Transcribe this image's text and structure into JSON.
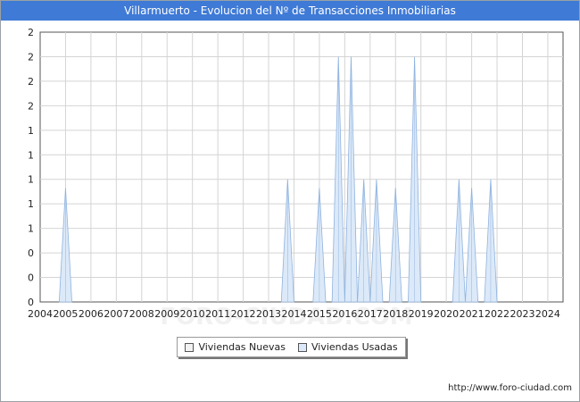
{
  "title": "Villarmuerto - Evolucion del Nº de Transacciones Inmobiliarias",
  "source": "http://www.foro-ciudad.com",
  "watermark": "FORO-CIUDAD.COM",
  "colors": {
    "title_bg": "#3f7ad6",
    "nuevas_fill": "#f2f2f2",
    "usadas_fill": "#dce9f8",
    "usadas_stroke": "#8fb3e0",
    "grid": "#d4d4d4"
  },
  "chart_data": {
    "type": "area",
    "title": "Villarmuerto - Evolucion del Nº de Transacciones Inmobiliarias",
    "xlabel": "",
    "ylabel": "",
    "xlim": [
      2004,
      2024.6
    ],
    "ylim": [
      0,
      2.2
    ],
    "x_ticks": [
      2004,
      2005,
      2006,
      2007,
      2008,
      2009,
      2010,
      2011,
      2012,
      2013,
      2014,
      2015,
      2016,
      2017,
      2018,
      2019,
      2020,
      2021,
      2022,
      2023,
      2024
    ],
    "y_tick_values": [
      0,
      0.2,
      0.4,
      0.6,
      0.8,
      1.0,
      1.2,
      1.4,
      1.6,
      1.8,
      2.0,
      2.2
    ],
    "y_tick_labels": [
      "0",
      "0",
      "0",
      "1",
      "1",
      "1",
      "1",
      "1",
      "2",
      "2",
      "2",
      "2"
    ],
    "grid": true,
    "legend_position": "bottom-center",
    "series": [
      {
        "name": "Viviendas Nuevas",
        "peaks": []
      },
      {
        "name": "Viviendas Usadas",
        "peaks": [
          {
            "x": 2005.0,
            "y": 0.93
          },
          {
            "x": 2013.75,
            "y": 1.0
          },
          {
            "x": 2015.0,
            "y": 0.93
          },
          {
            "x": 2015.75,
            "y": 2.0
          },
          {
            "x": 2016.25,
            "y": 2.0
          },
          {
            "x": 2016.75,
            "y": 1.0
          },
          {
            "x": 2017.25,
            "y": 1.0
          },
          {
            "x": 2018.0,
            "y": 0.93
          },
          {
            "x": 2018.75,
            "y": 2.0
          },
          {
            "x": 2020.5,
            "y": 1.0
          },
          {
            "x": 2021.0,
            "y": 0.93
          },
          {
            "x": 2021.75,
            "y": 1.0
          }
        ]
      }
    ]
  }
}
